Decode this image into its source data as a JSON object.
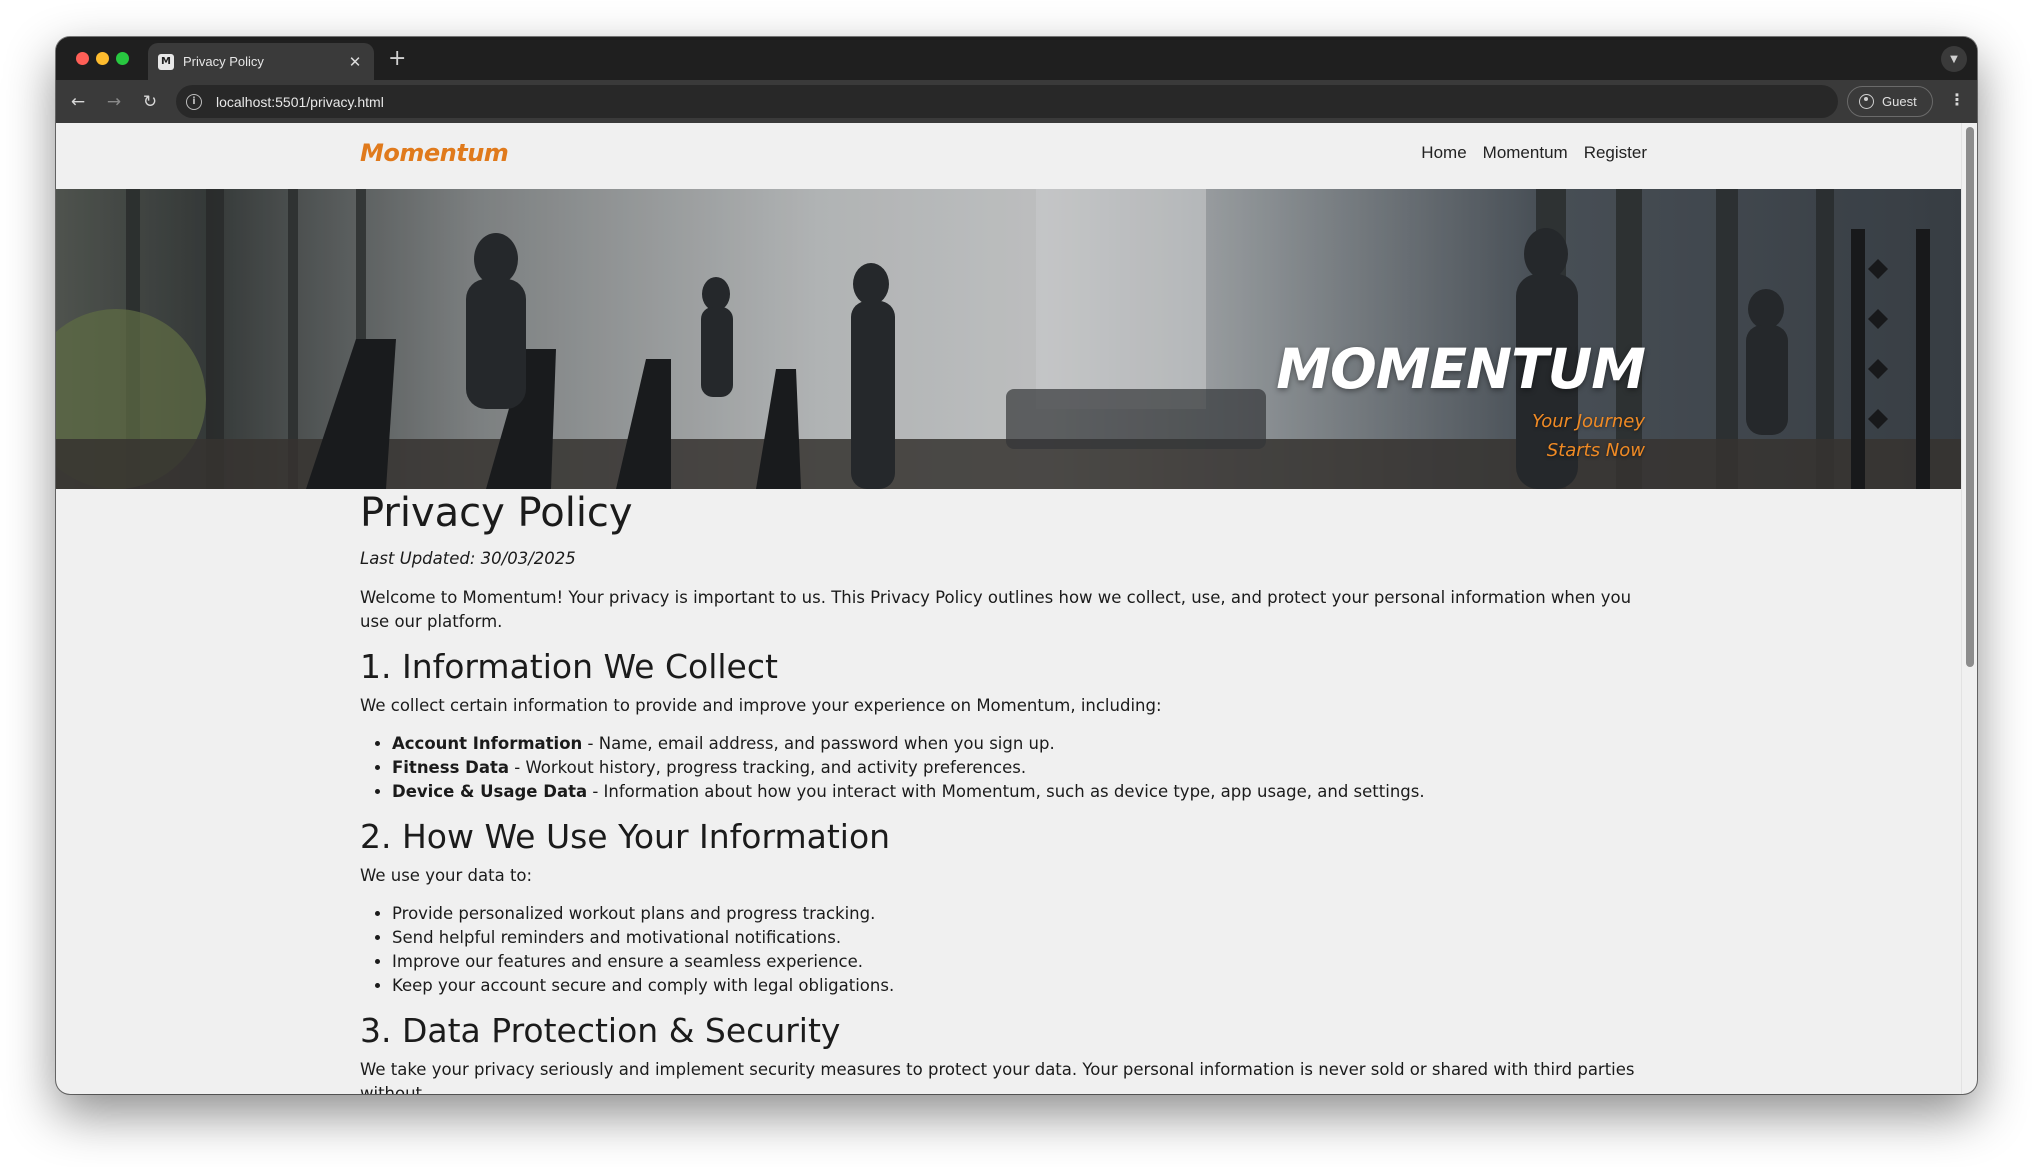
{
  "browser": {
    "tab_title": "Privacy Policy",
    "favicon_text": "M",
    "url": "localhost:5501/privacy.html",
    "profile_label": "Guest"
  },
  "site": {
    "logo": "Momentum",
    "nav": [
      "Home",
      "Momentum",
      "Register"
    ],
    "hero_title": "MOMENTUM",
    "hero_tagline": "Your Journey Starts Now",
    "accent_color": "#e07a1c"
  },
  "page": {
    "title": "Privacy Policy",
    "last_updated": "Last Updated: 30/03/2025",
    "intro": "Welcome to Momentum! Your privacy is important to us. This Privacy Policy outlines how we collect, use, and protect your personal information when you use our platform.",
    "sections": [
      {
        "heading": "1. Information We Collect",
        "intro": "We collect certain information to provide and improve your experience on Momentum, including:",
        "items": [
          {
            "term": "Account Information",
            "text": " - Name, email address, and password when you sign up."
          },
          {
            "term": "Fitness Data",
            "text": " - Workout history, progress tracking, and activity preferences."
          },
          {
            "term": "Device & Usage Data",
            "text": " - Information about how you interact with Momentum, such as device type, app usage, and settings."
          }
        ]
      },
      {
        "heading": "2. How We Use Your Information",
        "intro": "We use your data to:",
        "items": [
          {
            "text": "Provide personalized workout plans and progress tracking."
          },
          {
            "text": "Send helpful reminders and motivational notifications."
          },
          {
            "text": "Improve our features and ensure a seamless experience."
          },
          {
            "text": "Keep your account secure and comply with legal obligations."
          }
        ]
      },
      {
        "heading": "3. Data Protection & Security",
        "intro": "We take your privacy seriously and implement security measures to protect your data. Your personal information is never sold or shared with third parties without"
      }
    ]
  }
}
